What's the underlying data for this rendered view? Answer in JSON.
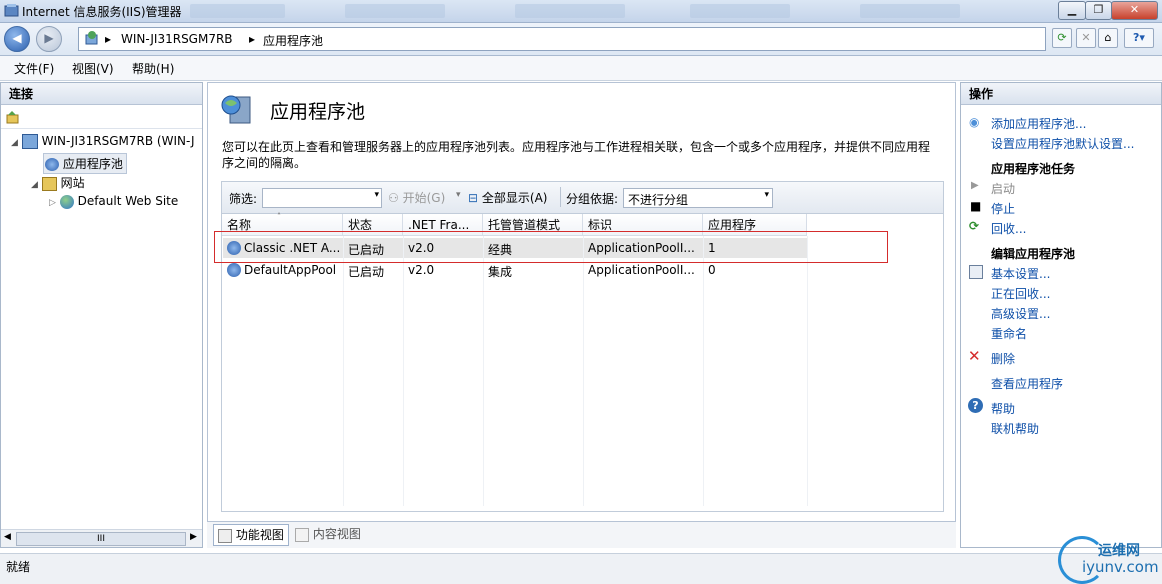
{
  "window": {
    "title": "Internet 信息服务(IIS)管理器"
  },
  "address": {
    "server": "WIN-JI31RSGM7RB",
    "separator": "▸",
    "page": "应用程序池"
  },
  "menu": [
    "文件(F)",
    "视图(V)",
    "帮助(H)"
  ],
  "connections": {
    "header": "连接",
    "tree": {
      "server": "WIN-JI31RSGM7RB (WIN-J",
      "app_pools": "应用程序池",
      "sites": "网站",
      "default_site": "Default Web Site"
    },
    "scrollbar_label": "III"
  },
  "main": {
    "title": "应用程序池",
    "description": "您可以在此页上查看和管理服务器上的应用程序池列表。应用程序池与工作进程相关联，包含一个或多个应用程序，并提供不同应用程序之间的隔离。",
    "toolbar": {
      "filter_label": "筛选:",
      "start_label": "开始(G)",
      "show_all_label": "全部显示(A)",
      "group_label": "分组依据:",
      "group_value": "不进行分组"
    },
    "columns": [
      "名称",
      "状态",
      ".NET Fra...",
      "托管管道模式",
      "标识",
      "应用程序"
    ],
    "rows": [
      {
        "name": "Classic .NET A...",
        "status": "已启动",
        "net": "v2.0",
        "pipeline": "经典",
        "identity": "ApplicationPoolI...",
        "apps": "1"
      },
      {
        "name": "DefaultAppPool",
        "status": "已启动",
        "net": "v2.0",
        "pipeline": "集成",
        "identity": "ApplicationPoolI...",
        "apps": "0"
      }
    ],
    "tabs": {
      "features": "功能视图",
      "content": "内容视图"
    }
  },
  "actions": {
    "header": "操作",
    "add": "添加应用程序池...",
    "set_defaults": "设置应用程序池默认设置...",
    "tasks_header": "应用程序池任务",
    "start": "启动",
    "stop": "停止",
    "recycle": "回收...",
    "edit_header": "编辑应用程序池",
    "basic": "基本设置...",
    "recycling": "正在回收...",
    "advanced": "高级设置...",
    "rename": "重命名",
    "delete": "删除",
    "view_apps": "查看应用程序",
    "help": "帮助",
    "online_help": "联机帮助"
  },
  "status": {
    "text": "就绪"
  },
  "watermark": {
    "line1": "运维网",
    "line2": "iyunv.com"
  },
  "colors": {
    "link": "#0e4fa8",
    "highlight_box": "#d42c2c",
    "selected_row": "#e6e6e6"
  }
}
